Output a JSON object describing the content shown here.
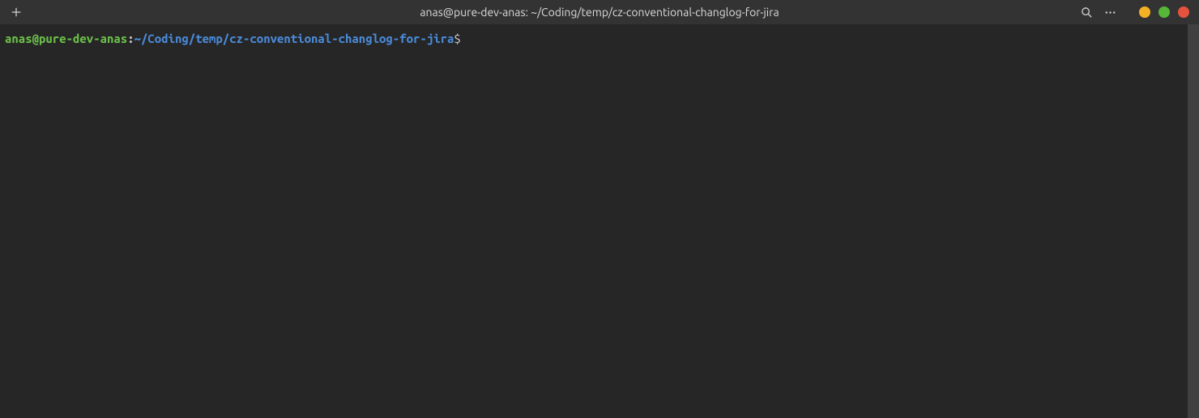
{
  "titlebar": {
    "title": "anas@pure-dev-anas: ~/Coding/temp/cz-conventional-changlog-for-jira"
  },
  "prompt": {
    "user_host": "anas@pure-dev-anas",
    "separator": ":",
    "path": "~/Coding/temp/cz-conventional-changlog-for-jira",
    "symbol": "$"
  }
}
